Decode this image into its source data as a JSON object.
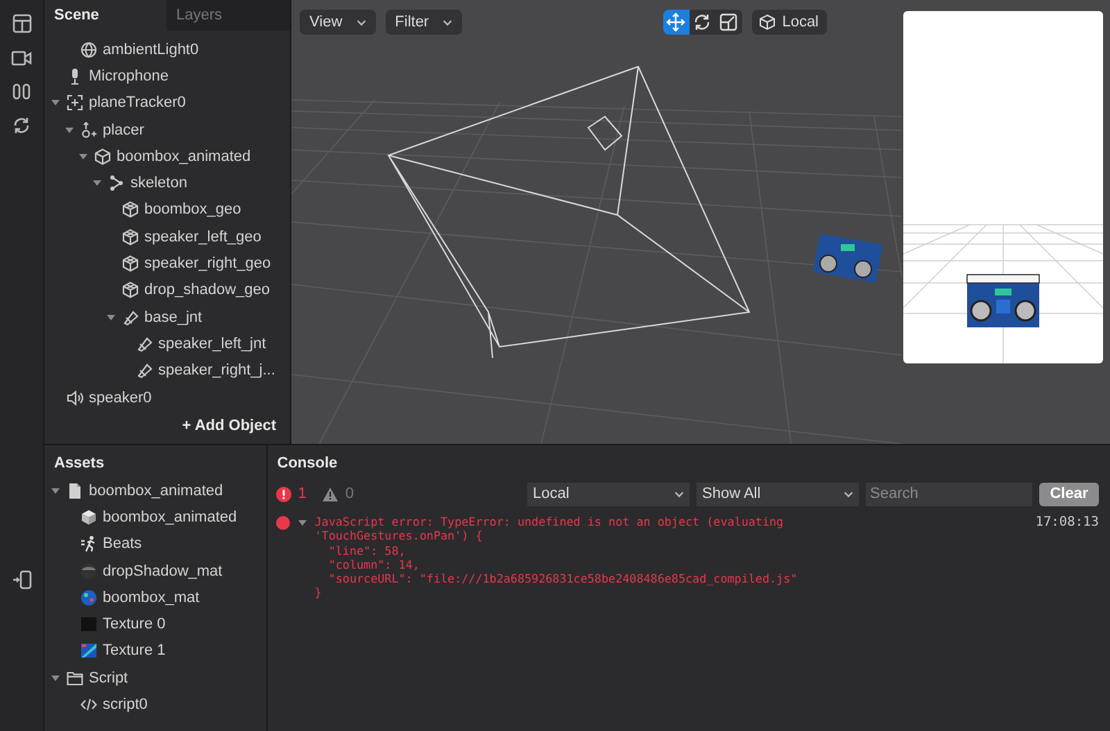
{
  "scene_panel": {
    "tabs": [
      {
        "label": "Scene",
        "selected": true
      },
      {
        "label": "Layers",
        "selected": false
      }
    ],
    "tree": [
      {
        "children": [
          {
            "label": "ambientLight0",
            "kind": "light"
          }
        ]
      },
      {
        "label": "Microphone",
        "kind": "mic"
      },
      {
        "label": "planeTracker0",
        "kind": "tracker",
        "expanded": true,
        "children": [
          {
            "label": "placer",
            "kind": "placer",
            "expanded": true,
            "children": [
              {
                "label": "boombox_animated",
                "kind": "object",
                "expanded": true,
                "children": [
                  {
                    "label": "skeleton",
                    "kind": "skeleton",
                    "expanded": true,
                    "children": [
                      {
                        "label": "boombox_geo",
                        "kind": "mesh"
                      },
                      {
                        "label": "speaker_left_geo",
                        "kind": "mesh"
                      },
                      {
                        "label": "speaker_right_geo",
                        "kind": "mesh"
                      },
                      {
                        "label": "drop_shadow_geo",
                        "kind": "mesh"
                      },
                      {
                        "label": "base_jnt",
                        "kind": "joint",
                        "expanded": true,
                        "children": [
                          {
                            "label": "speaker_left_jnt",
                            "kind": "joint"
                          },
                          {
                            "label": "speaker_right_j...",
                            "kind": "joint"
                          }
                        ]
                      }
                    ]
                  }
                ]
              }
            ]
          }
        ]
      },
      {
        "label": "speaker0",
        "kind": "speaker"
      }
    ],
    "add_button": "+ Add Object"
  },
  "viewport": {
    "view_menu": "View",
    "filter_menu": "Filter",
    "transform_tools": [
      {
        "kind": "move",
        "selected": true
      },
      {
        "kind": "rotate",
        "selected": false
      },
      {
        "kind": "scale",
        "selected": false
      }
    ],
    "space_button": "Local"
  },
  "assets_panel": {
    "title": "Assets",
    "tree": [
      {
        "label": "boombox_animated",
        "kind": "file",
        "expanded": true,
        "children": [
          {
            "label": "boombox_animated",
            "kind": "mesh-asset"
          },
          {
            "label": "Beats",
            "kind": "animation"
          },
          {
            "label": "dropShadow_mat",
            "kind": "material-dark"
          },
          {
            "label": "boombox_mat",
            "kind": "material-blue"
          },
          {
            "label": "Texture 0",
            "kind": "texture-dark"
          },
          {
            "label": "Texture 1",
            "kind": "texture-blue"
          }
        ]
      },
      {
        "label": "Script",
        "kind": "folder",
        "expanded": true,
        "children": [
          {
            "label": "script0",
            "kind": "code"
          }
        ]
      }
    ]
  },
  "console": {
    "title": "Console",
    "error_count": "1",
    "warning_count": "0",
    "source_select": "Local",
    "level_select": "Show All",
    "search": {
      "placeholder": "Search"
    },
    "clear_button": "Clear",
    "messages": [
      {
        "kind": "error",
        "expanded": true,
        "text": "JavaScript error: TypeError: undefined is not an object (evaluating\n'TouchGestures.onPan') {\n  \"line\": 58,\n  \"column\": 14,\n  \"sourceURL\": \"file:///1b2a685926831ce58be2408486e85cad_compiled.js\"\n}",
        "time": "17:08:13"
      }
    ]
  }
}
